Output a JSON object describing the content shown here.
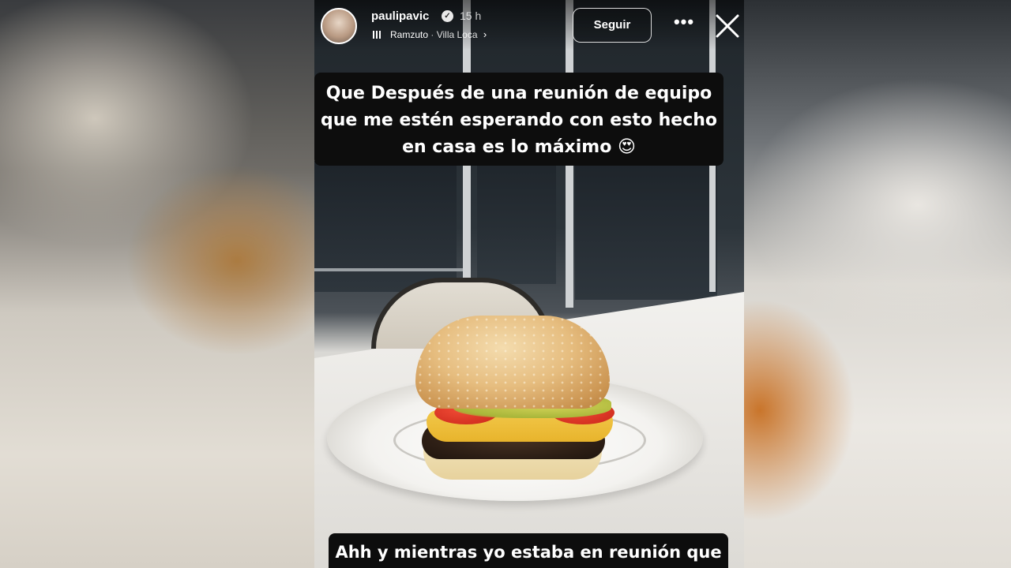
{
  "story": {
    "username": "paulipavic",
    "timestamp": "15 h",
    "music": {
      "artist": "Ramzuto",
      "separator": "·",
      "place": "Villa Loca"
    },
    "follow_label": "Seguir",
    "more_label": "•••",
    "caption_lines": [
      "Que Después de una reunión de equipo",
      "que me estén esperando con esto hecho",
      "en casa es lo máximo 😍"
    ],
    "caption_bottom": "Ahh y mientras yo estaba en reunión que lleve a mi"
  },
  "icons": {
    "verified": "verified-icon",
    "music": "music-icon",
    "chevron": "chevron-right-icon",
    "more": "more-icon",
    "close": "close-icon"
  }
}
